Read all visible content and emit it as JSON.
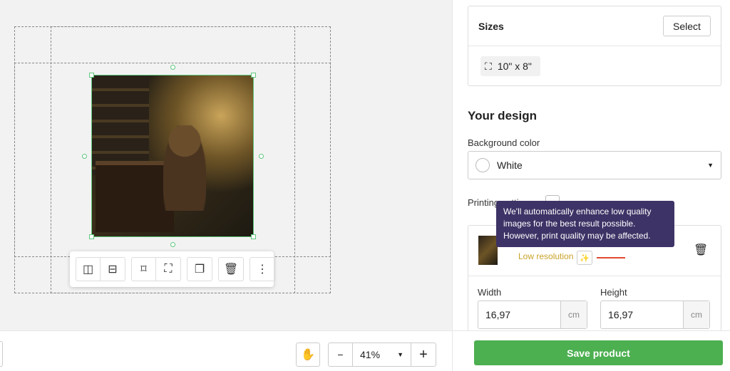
{
  "canvas": {
    "toolbar": {
      "icons": [
        "flip-horizontal-icon",
        "flip-vertical-icon",
        "fit-icon",
        "fill-icon",
        "duplicate-icon",
        "trash-icon",
        "more-icon"
      ]
    }
  },
  "bottom": {
    "zoom_value": "41%",
    "minus": "−",
    "plus": "+"
  },
  "sizes": {
    "title": "Sizes",
    "select_label": "Select",
    "size_value": "10\" x 8\""
  },
  "design": {
    "title": "Your design",
    "bg_label": "Background color",
    "bg_value": "White",
    "printing_label": "Printing settings:"
  },
  "image_item": {
    "status": "Low resolution",
    "status_color": "#c9a227"
  },
  "tooltip": {
    "text": "We'll automatically enhance low quality images for the best result possible. However, print quality may be affected."
  },
  "dimensions": {
    "width_label": "Width",
    "width_value": "16,97",
    "height_label": "Height",
    "height_value": "16,97",
    "unit": "cm"
  },
  "save_label": "Save product",
  "colors": {
    "accent": "#4caf50",
    "tooltip": "#3e3366",
    "selection": "#5fc77e"
  }
}
